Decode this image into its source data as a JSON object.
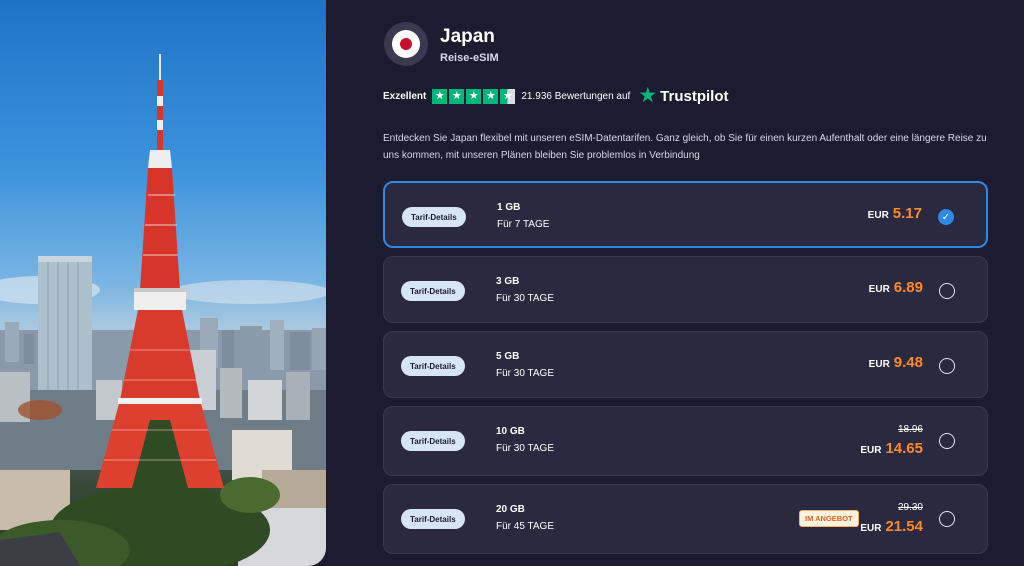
{
  "header": {
    "country": "Japan",
    "subtitle": "Reise-eSIM"
  },
  "rating": {
    "label": "Exzellent",
    "reviews_text": "21.936 Bewertungen auf",
    "provider": "Trustpilot",
    "stars": 4.5
  },
  "description": "Entdecken Sie Japan flexibel mit unseren eSIM-Datentarifen. Ganz gleich, ob Sie für einen kurzen Aufenthalt oder eine längere Reise zu uns kommen, mit unseren Plänen bleiben Sie problemlos in Verbindung",
  "plans": [
    {
      "details_label": "Tarif-Details",
      "size": "1 GB",
      "duration": "Für 7 TAGE",
      "currency": "EUR",
      "price": "5.17",
      "old_price": null,
      "badge": null,
      "selected": true
    },
    {
      "details_label": "Tarif-Details",
      "size": "3 GB",
      "duration": "Für 30 TAGE",
      "currency": "EUR",
      "price": "6.89",
      "old_price": null,
      "badge": null,
      "selected": false
    },
    {
      "details_label": "Tarif-Details",
      "size": "5 GB",
      "duration": "Für 30 TAGE",
      "currency": "EUR",
      "price": "9.48",
      "old_price": null,
      "badge": null,
      "selected": false
    },
    {
      "details_label": "Tarif-Details",
      "size": "10 GB",
      "duration": "Für 30 TAGE",
      "currency": "EUR",
      "price": "14.65",
      "old_price": "18.96",
      "badge": null,
      "selected": false
    },
    {
      "details_label": "Tarif-Details",
      "size": "20 GB",
      "duration": "Für 45 TAGE",
      "currency": "EUR",
      "price": "21.54",
      "old_price": "29.30",
      "badge": "IM ANGEBOT",
      "selected": false
    }
  ],
  "colors": {
    "background": "#1c1b2f",
    "card": "#2a293f",
    "accent_blue": "#2e88e6",
    "price_orange": "#ff8a2b",
    "trustpilot_green": "#00b67a"
  },
  "icons": {
    "flag": "japan-flag-icon",
    "star": "trustpilot-star-icon",
    "check": "check-icon"
  }
}
